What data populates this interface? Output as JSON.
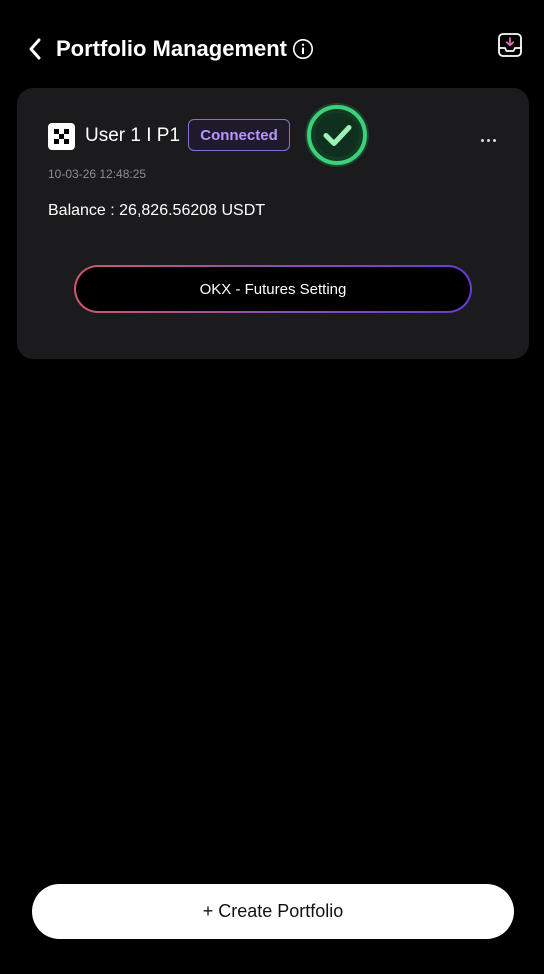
{
  "header": {
    "title": "Portfolio Management",
    "back_icon": "chevron-left-icon",
    "info_icon": "info-circle-icon",
    "action_icon": "download-tray-icon"
  },
  "portfolio_card": {
    "exchange_icon": "okx-logo-icon",
    "user_name": "User 1 I P1",
    "status": "Connected",
    "status_icon": "check-circle-icon",
    "menu_icon": "more-horizontal-icon",
    "timestamp": "10-03-26 12:48:25",
    "balance": "Balance : 26,826.56208 USDT",
    "settings_button": "OKX - Futures Setting"
  },
  "footer": {
    "create_button": "+ Create Portfolio"
  },
  "colors": {
    "background": "#000000",
    "card": "#1b1b1d",
    "badge_text": "#b597ff",
    "badge_border": "#8a6fd1",
    "check_green": "#3ad17a",
    "gradient_start": "#d0576e",
    "gradient_end": "#6a3ad6"
  }
}
